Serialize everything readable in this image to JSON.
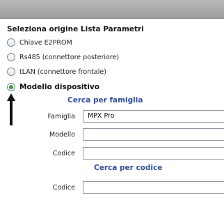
{
  "header": {
    "section_title": "Seleziona origine Lista Parametri"
  },
  "options": [
    {
      "label": "Chiave E2PROM",
      "selected": false
    },
    {
      "label": "Rs485 (connettore posteriore)",
      "selected": false
    },
    {
      "label": "tLAN (connettore frontale)",
      "selected": false
    },
    {
      "label": "Modello dispositivo",
      "selected": true
    }
  ],
  "family_search": {
    "title": "Cerca per famiglia",
    "fields": [
      {
        "label": "Famiglia",
        "value": "MPX Pro"
      },
      {
        "label": "Modello",
        "value": ""
      },
      {
        "label": "Codice",
        "value": ""
      }
    ]
  },
  "code_search": {
    "title": "Cerca per codice",
    "fields": [
      {
        "label": "Codice",
        "value": ""
      }
    ]
  },
  "colors": {
    "group_title": "#2f4fa0",
    "radio_selected": "#3f9c3a"
  },
  "icons": {
    "pointer": "arrow-pointer-icon"
  }
}
